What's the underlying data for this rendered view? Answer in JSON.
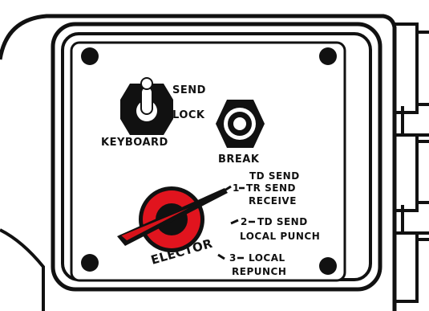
{
  "colors": {
    "ink": "#111111",
    "paper": "#ffffff",
    "knob_red": "#e1141e",
    "pointer_red": "#d8121a"
  },
  "toggle_switch": {
    "icon": "toggle-switch-icon",
    "label_up": "SEND",
    "label_down": "LOCK",
    "label_name": "KEYBOARD"
  },
  "push_button": {
    "icon": "push-button-icon",
    "label": "BREAK"
  },
  "selector": {
    "icon": "rotary-knob-icon",
    "label_partial": "ELECTOR",
    "positions": [
      {
        "number": "1",
        "lines": [
          "TD SEND",
          "TR SEND",
          "RECEIVE"
        ]
      },
      {
        "number": "2",
        "lines": [
          "TD SEND",
          "LOCAL PUNCH"
        ]
      },
      {
        "number": "3",
        "lines": [
          "LOCAL",
          "REPUNCH"
        ]
      }
    ],
    "selected_position": "1"
  }
}
